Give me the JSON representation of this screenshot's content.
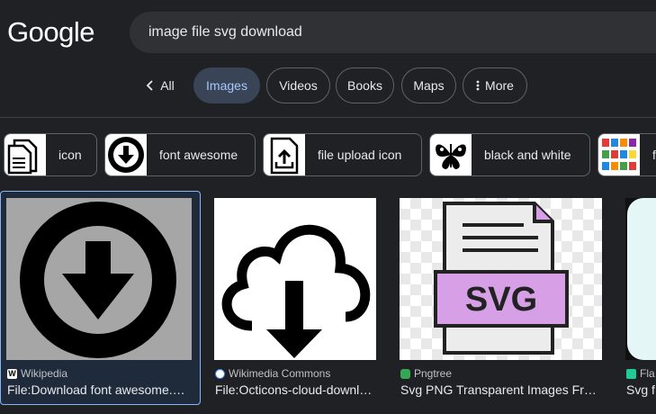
{
  "logo": {
    "text": "Google"
  },
  "search": {
    "query": "image file svg download"
  },
  "tabs": [
    {
      "label": "All",
      "icon": "chevron-left-icon"
    },
    {
      "label": "Images"
    },
    {
      "label": "Videos"
    },
    {
      "label": "Books"
    },
    {
      "label": "Maps"
    },
    {
      "label": "More",
      "icon": "more-vert-icon"
    }
  ],
  "chips": [
    {
      "label": "icon",
      "thumb_icon": "document-icon"
    },
    {
      "label": "font awesome",
      "thumb_icon": "download-circle-icon"
    },
    {
      "label": "file upload icon",
      "thumb_icon": "file-upload-icon"
    },
    {
      "label": "black and white",
      "thumb_icon": "butterfly-icon"
    },
    {
      "label": "f",
      "thumb_icon": "file-grid-icon"
    }
  ],
  "results": [
    {
      "source": "Wikipedia",
      "title": "File:Download font awesome.svg - Wikimedia",
      "favicon": "wikipedia-icon"
    },
    {
      "source": "Wikimedia Commons",
      "title": "File:Octicons-cloud-download.svg",
      "favicon": "wikimedia-icon"
    },
    {
      "source": "Pngtree",
      "title": "Svg PNG Transparent Images Free Download",
      "image_text": "SVG",
      "favicon": "pngtree-icon"
    },
    {
      "source": "Fla",
      "title": "Svg f",
      "favicon": "flaticon-icon"
    }
  ],
  "colors": {
    "background": "#202124",
    "active_tab": "#394457",
    "active_tab_text": "#a8c7fa",
    "selected_border": "#8ab4f8",
    "svg_purple": "#d79fe6"
  }
}
